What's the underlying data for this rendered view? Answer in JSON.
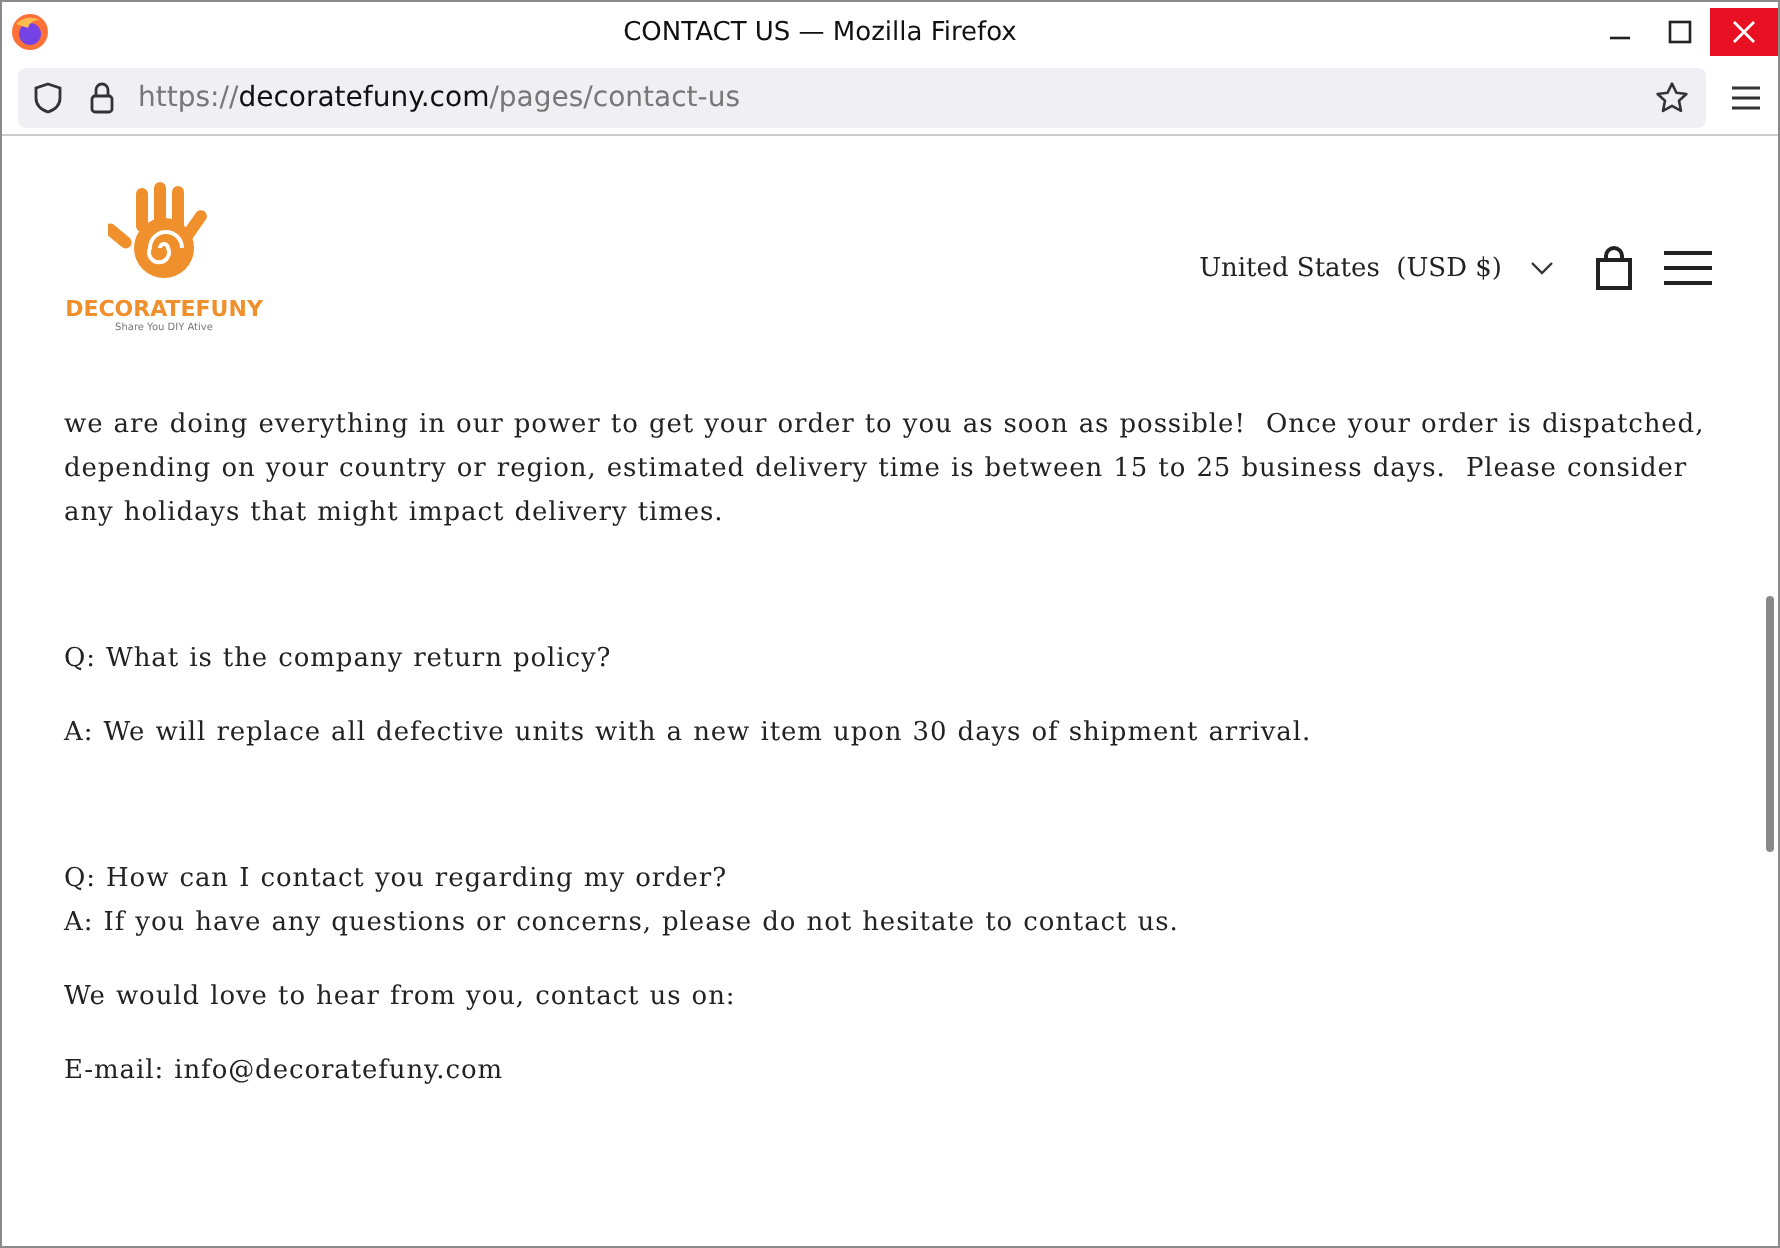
{
  "window": {
    "title": "CONTACT US — Mozilla Firefox"
  },
  "address_bar": {
    "scheme": "https://",
    "domain": "decoratefuny.com",
    "path": "/pages/contact-us"
  },
  "header": {
    "logo_name": "DECORATEFUNY",
    "logo_tagline": "Share You DIY Ative",
    "currency": "United States  (USD $)"
  },
  "sections": [
    {
      "blocks": [
        {
          "lines": [
            "we are doing everything in our power to get your order to you as soon as possible!  Once your order is dispatched, depending on your country or region, estimated delivery time is between 15 to 25 business days.  Please consider any holidays that might impact delivery times."
          ]
        }
      ]
    },
    {
      "blocks": [
        {
          "lines": [
            "Q: What is the company return policy?"
          ]
        },
        {
          "lines": [
            "A: We will replace all defective units with a new item upon 30 days of shipment arrival."
          ]
        }
      ]
    },
    {
      "blocks": [
        {
          "lines": [
            "Q: How can I contact you regarding my order?",
            "A: If you have any questions or concerns, please do not hesitate to contact us."
          ]
        },
        {
          "lines": [
            "We would love to hear from you, contact us on:"
          ]
        },
        {
          "lines": [
            "E-mail: info@decoratefuny.com"
          ]
        }
      ]
    }
  ]
}
